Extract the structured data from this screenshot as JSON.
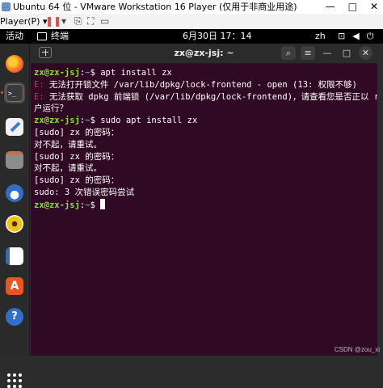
{
  "vm_window": {
    "title": "Ubuntu 64 位 - VMware Workstation 16 Player (仅用于非商业用途)",
    "player_menu": "Player(P) ▾",
    "buttons": {
      "minimize": "—",
      "restore": "□",
      "close": "✕"
    }
  },
  "top_panel": {
    "activities": "活动",
    "app_name": "终端",
    "clock": "6月30日  17：14",
    "input_method": "zh",
    "icons": [
      "network-icon",
      "volume-icon",
      "power-icon"
    ]
  },
  "dock": {
    "items": [
      "firefox",
      "terminal",
      "text-editor",
      "files",
      "thunderbird",
      "rhythmbox",
      "libreoffice-writer",
      "software-center",
      "help"
    ],
    "active": "terminal"
  },
  "terminal": {
    "title": "zx@zx-jsj: ~",
    "prompt_user": "zx@zx-jsj",
    "prompt_path": "~",
    "lines": [
      {
        "type": "prompt",
        "cmd": " apt install zx"
      },
      {
        "type": "error",
        "tag": "E:",
        "text": " 无法打开锁文件 /var/lib/dpkg/lock-frontend - open (13: 权限不够)"
      },
      {
        "type": "error",
        "tag": "E:",
        "text": " 无法获取 dpkg 前端锁 (/var/lib/dpkg/lock-frontend)，请查看您是否正以 root 用"
      },
      {
        "type": "text",
        "text": "户运行？"
      },
      {
        "type": "prompt",
        "cmd": " sudo apt install zx"
      },
      {
        "type": "text",
        "text": "[sudo] zx 的密码："
      },
      {
        "type": "text",
        "text": "对不起，请重试。"
      },
      {
        "type": "text",
        "text": "[sudo] zx 的密码："
      },
      {
        "type": "text",
        "text": "对不起，请重试。"
      },
      {
        "type": "text",
        "text": "[sudo] zx 的密码："
      },
      {
        "type": "text",
        "text": "sudo: 3 次错误密码尝试"
      },
      {
        "type": "prompt",
        "cmd": " ",
        "cursor": true
      }
    ]
  },
  "watermark": "CSDN @zou_xi",
  "colors": {
    "terminal_bg": "#300a24",
    "prompt_user": "#8ae234",
    "prompt_path": "#729fcf",
    "error": "#ef2929"
  }
}
